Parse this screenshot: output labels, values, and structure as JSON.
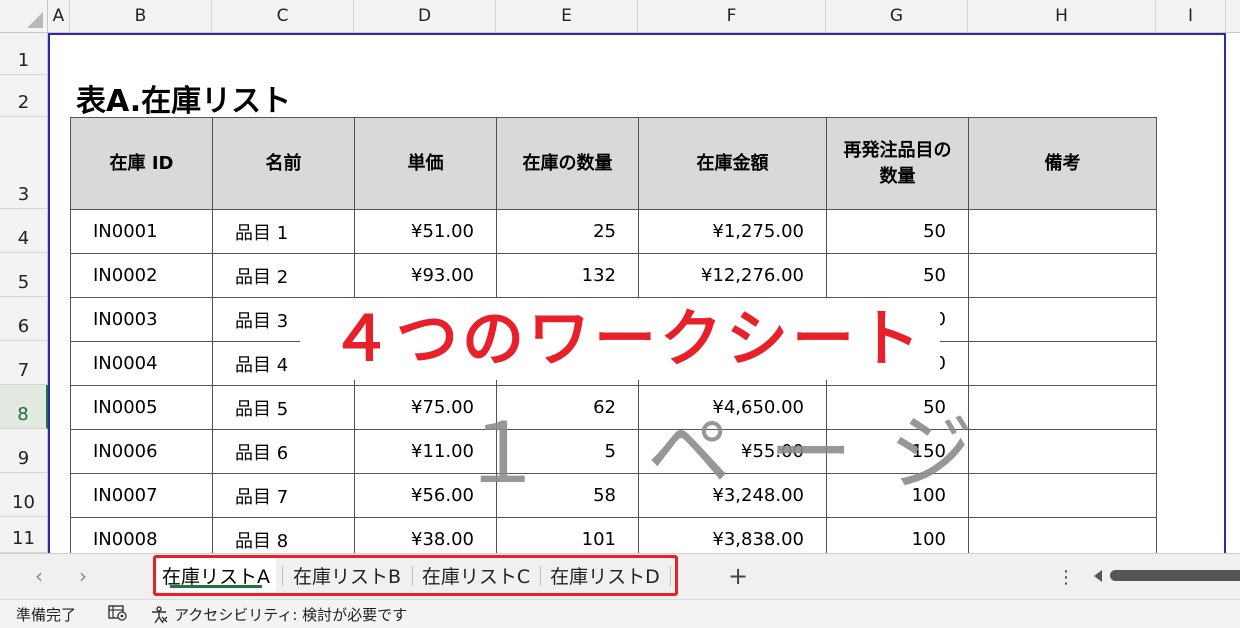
{
  "columns": [
    "A",
    "B",
    "C",
    "D",
    "E",
    "F",
    "G",
    "H",
    "I"
  ],
  "rows": [
    "1",
    "2",
    "3",
    "4",
    "5",
    "6",
    "7",
    "8",
    "9",
    "10",
    "11"
  ],
  "sheet": {
    "title": "表A.在庫リスト",
    "headers": [
      "在庫 ID",
      "名前",
      "単価",
      "在庫の数量",
      "在庫金額",
      "再発注品目の数量",
      "備考"
    ],
    "data": [
      [
        "IN0001",
        "品目 1",
        "¥51.00",
        "25",
        "¥1,275.00",
        "50",
        ""
      ],
      [
        "IN0002",
        "品目 2",
        "¥93.00",
        "132",
        "¥12,276.00",
        "50",
        ""
      ],
      [
        "IN0003",
        "品目 3",
        "",
        "",
        "",
        "0",
        ""
      ],
      [
        "IN0004",
        "品目 4",
        "",
        "",
        "",
        "0",
        ""
      ],
      [
        "IN0005",
        "品目 5",
        "¥75.00",
        "62",
        "¥4,650.00",
        "50",
        ""
      ],
      [
        "IN0006",
        "品目 6",
        "¥11.00",
        "5",
        "¥55.00",
        "150",
        ""
      ],
      [
        "IN0007",
        "品目 7",
        "¥56.00",
        "58",
        "¥3,248.00",
        "100",
        ""
      ],
      [
        "IN0008",
        "品目 8",
        "¥38.00",
        "101",
        "¥3,838.00",
        "100",
        ""
      ]
    ]
  },
  "overlay": {
    "banner": "４つのワークシート",
    "watermark": "１ ページ"
  },
  "tabs": {
    "prev_label": "‹",
    "next_label": "›",
    "items": [
      "在庫リストA",
      "在庫リストB",
      "在庫リストC",
      "在庫リストD"
    ],
    "active_index": 0,
    "add_label": "+",
    "more_label": "⋮"
  },
  "status": {
    "ready": "準備完了",
    "accessibility": "アクセシビリティ: 検討が必要です"
  },
  "colors": {
    "accent": "#217346",
    "highlight": "#e8202a",
    "selection": "#2b2bb0"
  }
}
